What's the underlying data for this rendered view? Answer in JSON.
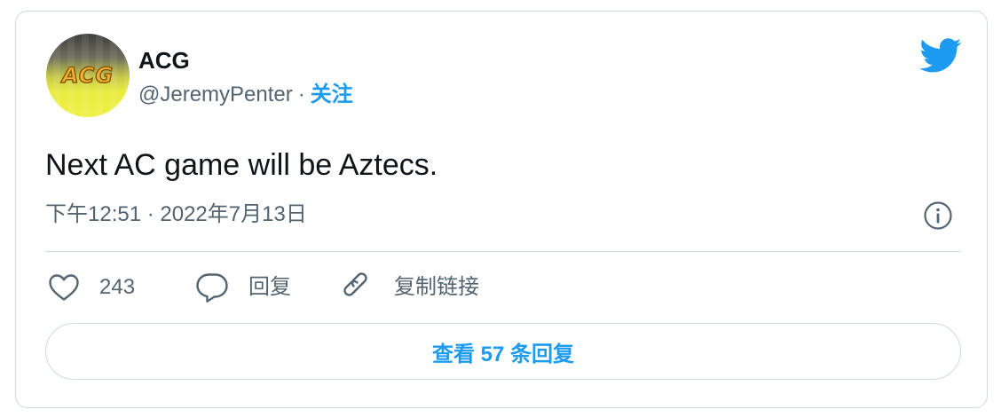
{
  "author": {
    "name": "ACG",
    "handle": "@JeremyPenter",
    "separator": "·",
    "follow_label": "关注",
    "avatar_logo_text": "ACG"
  },
  "tweet": {
    "text": "Next AC game will be Aztecs.",
    "timestamp": "下午12:51 · 2022年7月13日"
  },
  "actions": {
    "like_count": "243",
    "reply_label": "回复",
    "copy_link_label": "复制链接"
  },
  "view_replies_label": "查看 57 条回复",
  "icons": {
    "brand": "twitter-bird-icon",
    "info": "info-icon",
    "like": "heart-icon",
    "reply": "reply-bubble-icon",
    "copy": "link-icon"
  },
  "colors": {
    "accent": "#1d9bf0",
    "text_primary": "#0f1419",
    "text_secondary": "#536471",
    "border": "#cfd9de"
  }
}
